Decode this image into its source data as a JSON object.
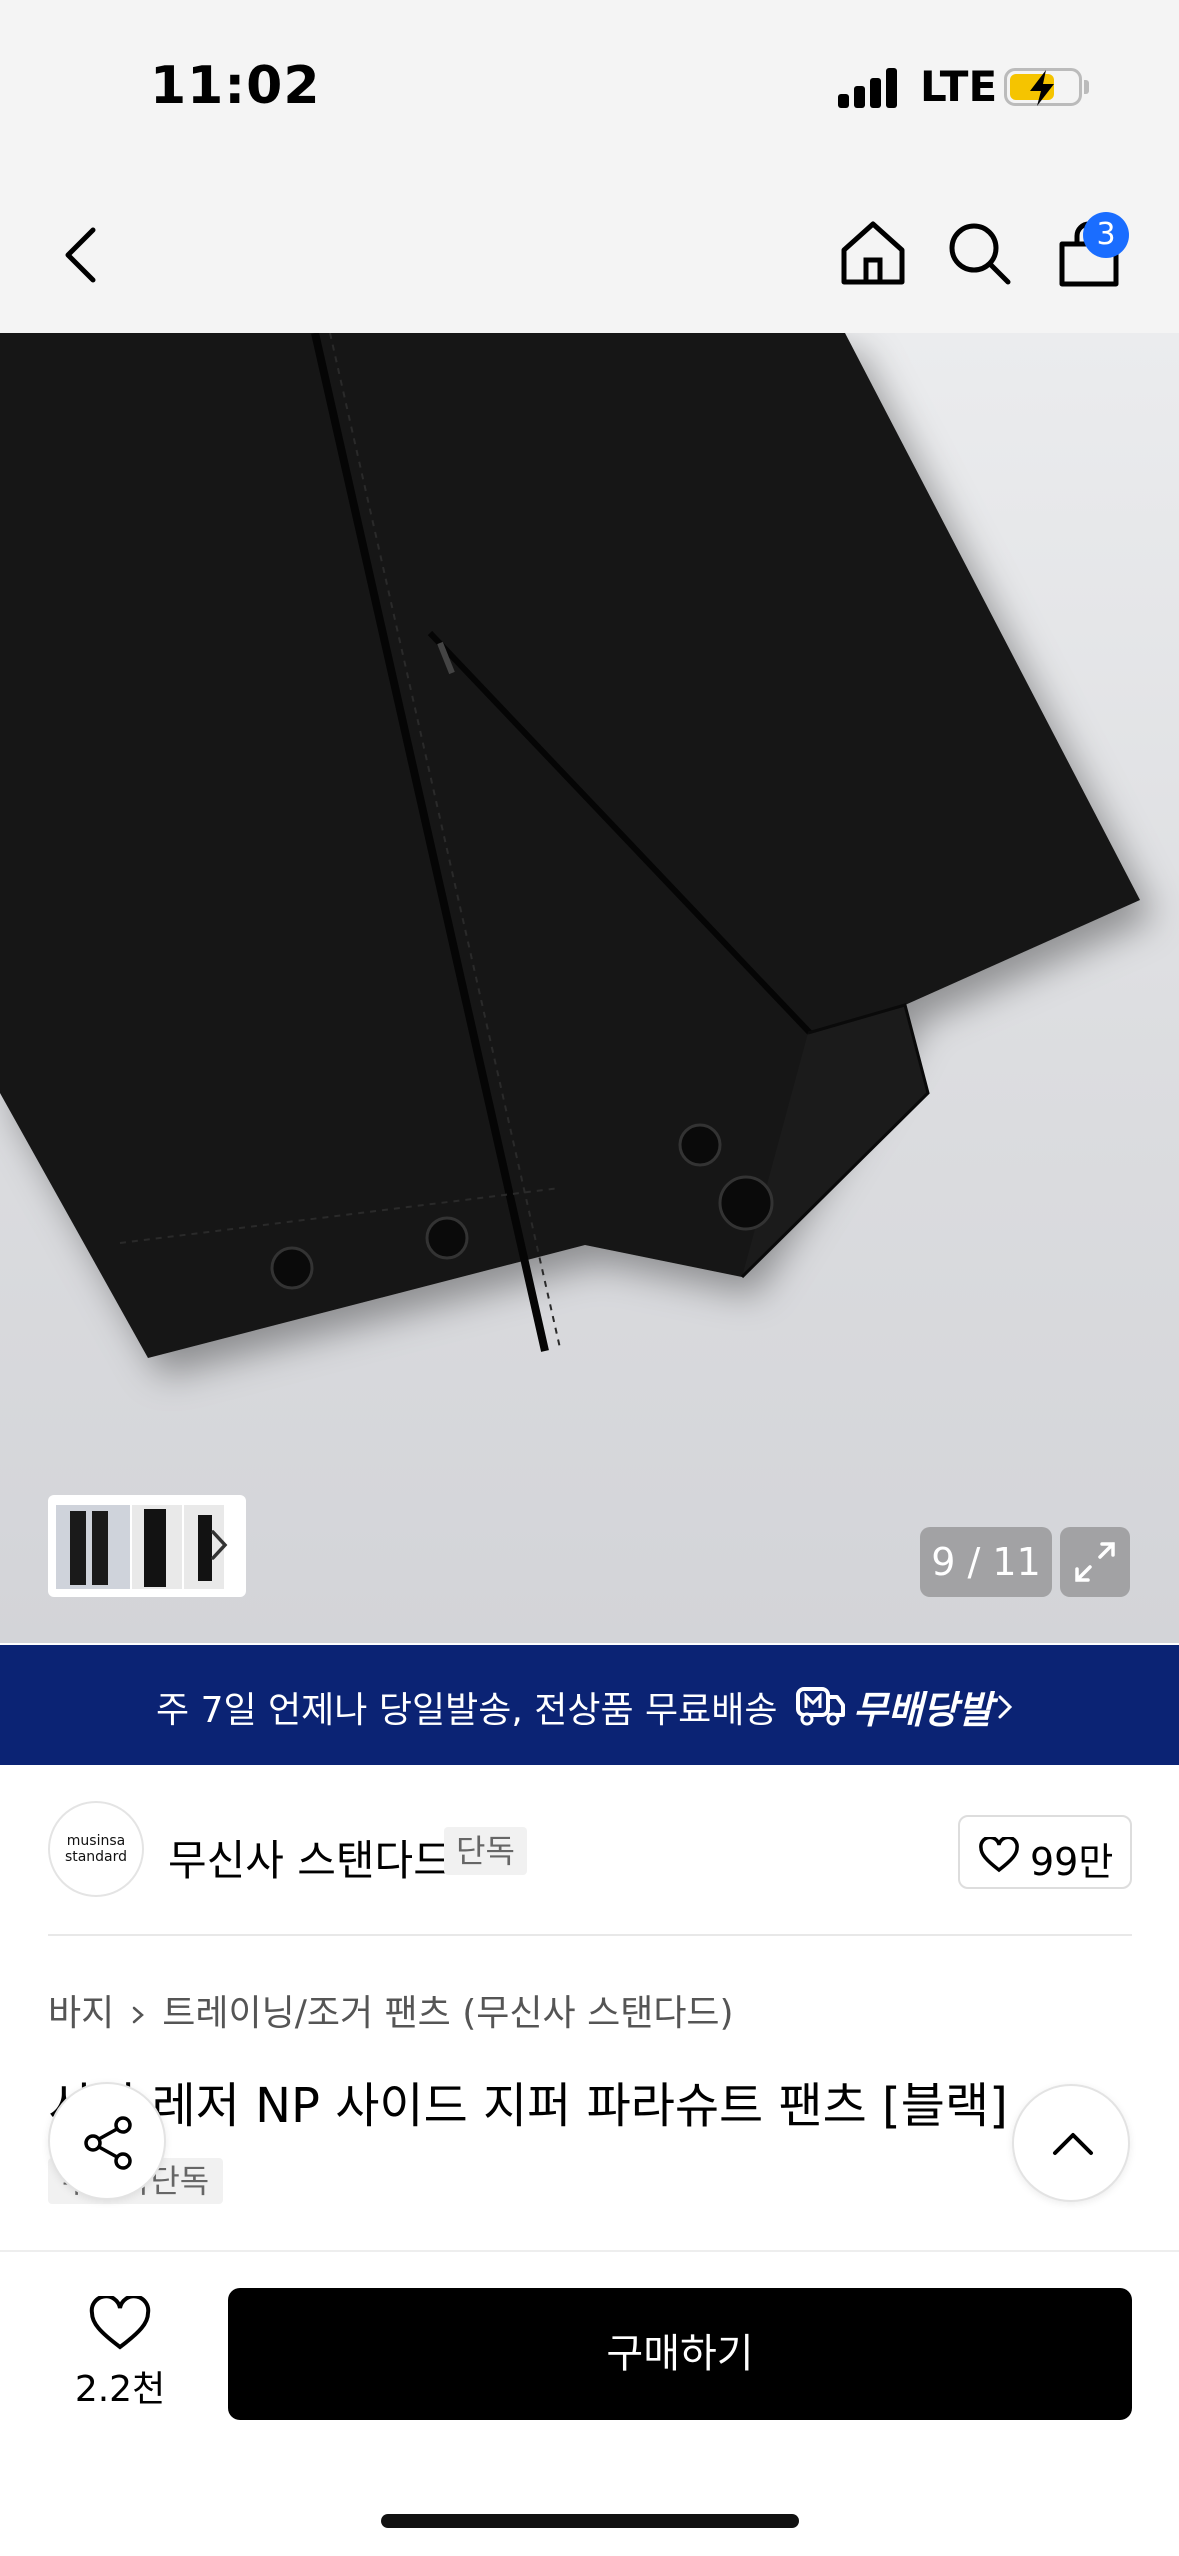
{
  "status_bar": {
    "time": "11:02",
    "network": "LTE",
    "battery": "charging"
  },
  "nav": {
    "back": "chevron-left-icon",
    "home": "home-icon",
    "search": "search-icon",
    "cart": "shopping-bag-icon",
    "cart_count": "3"
  },
  "gallery": {
    "counter": "9 / 11",
    "expand": "expand-icon"
  },
  "promo": {
    "text": "주 7일 언제나 당일발송, 전상품 무료배송",
    "brand": "무배당발",
    "color": "#0b2374"
  },
  "brand": {
    "logo_line1": "musinsa",
    "logo_line2": "standard",
    "name": "무신사 스탠다드",
    "tag": "단독",
    "likes": "99만"
  },
  "product": {
    "breadcrumb_1": "바지",
    "breadcrumb_2": "트레이닝/조거 팬츠 (무신사 스탠다드)",
    "title": "시티 레저 NP 사이드 지퍼 파라슈트 팬츠 [블랙]",
    "badge": "무신사단독"
  },
  "bottom": {
    "wish_count": "2.2천",
    "buy_label": "구매하기"
  }
}
